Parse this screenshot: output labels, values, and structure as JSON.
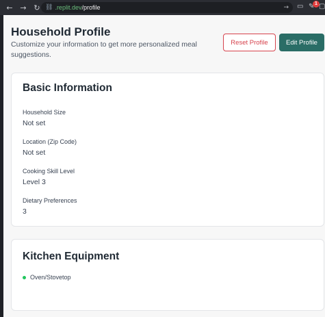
{
  "browser": {
    "back_icon": "←",
    "forward_icon": "→",
    "reload_icon": "↻",
    "url_host": ".replit.dev",
    "url_path": "/profile",
    "go_icon": "→",
    "badge_count": "1"
  },
  "header": {
    "title": "Household Profile",
    "subtitle": "Customize your information to get more personalized meal suggestions.",
    "reset_label": "Reset Profile",
    "edit_label": "Edit Profile"
  },
  "basic": {
    "title": "Basic Information",
    "fields": [
      {
        "label": "Household Size",
        "value": "Not set"
      },
      {
        "label": "Location (Zip Code)",
        "value": "Not set"
      },
      {
        "label": "Cooking Skill Level",
        "value": "Level 3"
      },
      {
        "label": "Dietary Preferences",
        "value": "3"
      }
    ]
  },
  "kitchen": {
    "title": "Kitchen Equipment",
    "items": [
      "Oven/Stovetop"
    ]
  },
  "colors": {
    "accent": "#2a6d66",
    "danger": "#d6424c",
    "status_dot": "#22c55e"
  }
}
